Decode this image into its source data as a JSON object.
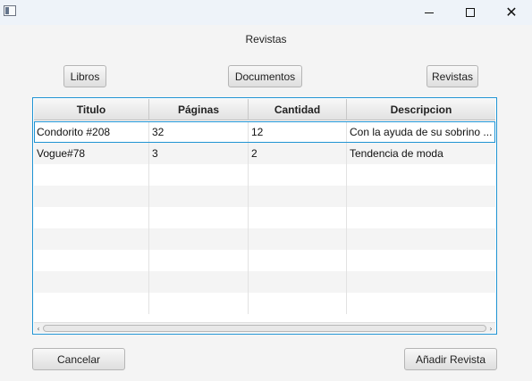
{
  "window": {
    "title_icon": "app-window-icon",
    "heading": "Revistas"
  },
  "nav": {
    "libros": "Libros",
    "documentos": "Documentos",
    "revistas": "Revistas"
  },
  "table": {
    "columns": [
      "Titulo",
      "Páginas",
      "Cantidad",
      "Descripcion"
    ],
    "rows": [
      [
        "Condorito #208",
        "32",
        "12",
        "Con la ayuda de su sobrino ..."
      ],
      [
        "Vogue#78",
        "3",
        "2",
        "Tendencia de moda"
      ]
    ],
    "selected_row": 0,
    "empty_rows": 7
  },
  "footer": {
    "cancel": "Cancelar",
    "add": "Añadir Revista"
  },
  "colors": {
    "focus_border": "#1f93d3",
    "titlebar": "#eef3f9"
  }
}
